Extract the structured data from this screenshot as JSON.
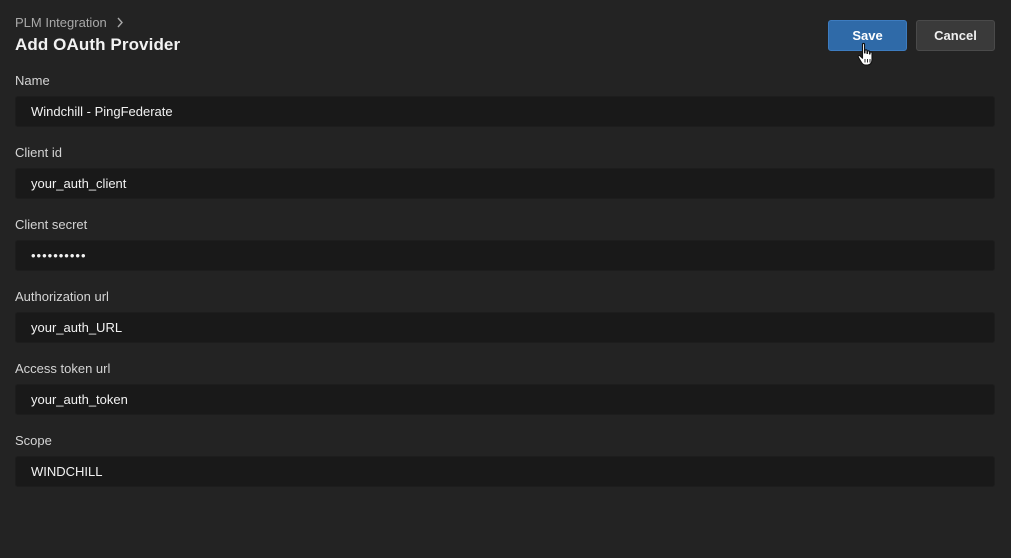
{
  "breadcrumb": {
    "parent": "PLM Integration"
  },
  "page": {
    "title": "Add OAuth Provider"
  },
  "actions": {
    "save_label": "Save",
    "cancel_label": "Cancel"
  },
  "form": {
    "fields": [
      {
        "label": "Name",
        "value": "Windchill - PingFederate",
        "type": "text"
      },
      {
        "label": "Client id",
        "value": "your_auth_client",
        "type": "text"
      },
      {
        "label": "Client secret",
        "value": "••••••••••",
        "type": "password"
      },
      {
        "label": "Authorization url",
        "value": "your_auth_URL",
        "type": "text"
      },
      {
        "label": "Access token url",
        "value": "your_auth_token",
        "type": "text"
      },
      {
        "label": "Scope",
        "value": "WINDCHILL",
        "type": "text"
      }
    ]
  },
  "colors": {
    "background": "#232323",
    "input_background": "#191919",
    "primary": "#2f6aa8",
    "secondary": "#3a3a3a"
  },
  "icons": {
    "breadcrumb_separator": "chevron-right-icon",
    "pointer": "hand-pointer-cursor-icon"
  }
}
